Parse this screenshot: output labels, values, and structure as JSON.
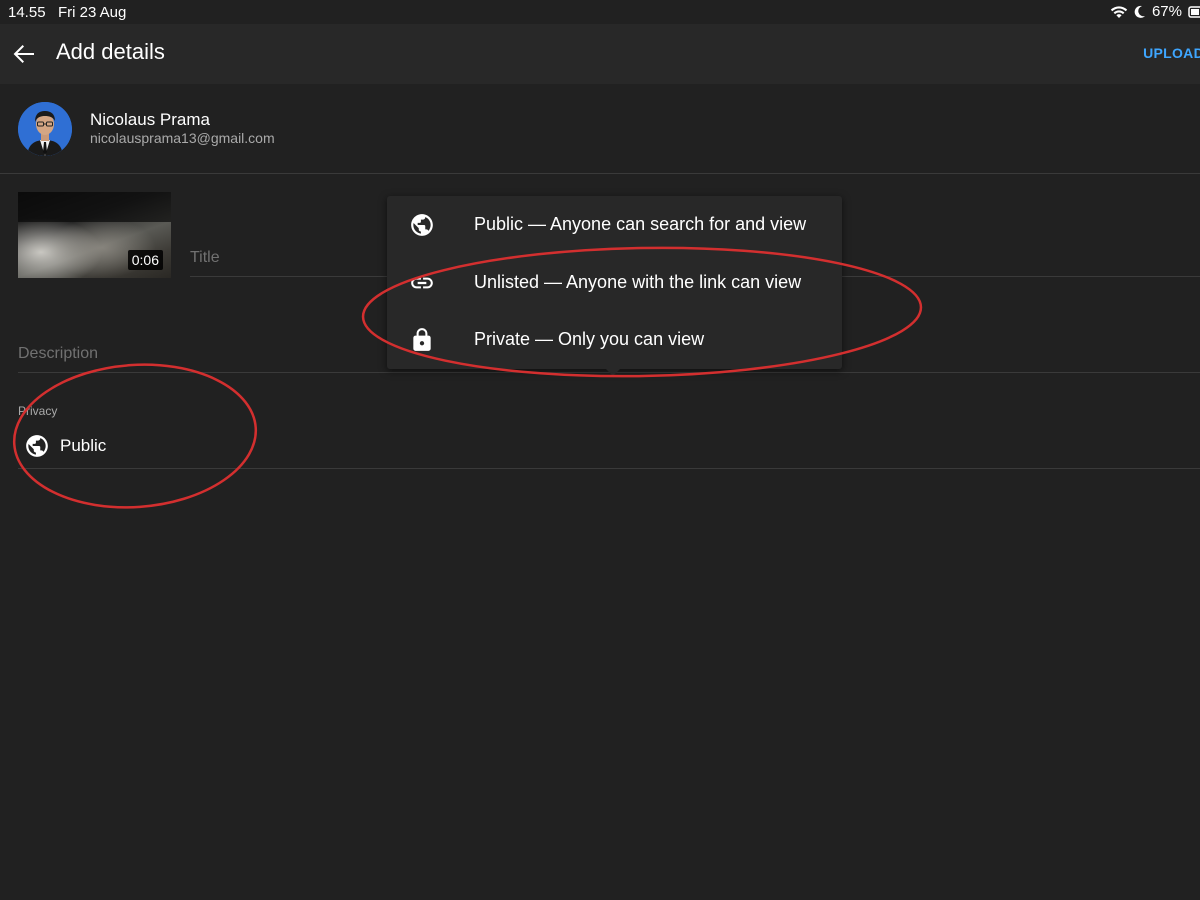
{
  "status_bar": {
    "time": "14.55",
    "date": "Fri 23 Aug",
    "battery": "67%",
    "icons": [
      "wifi-icon",
      "moon-icon",
      "battery-icon"
    ]
  },
  "app_bar": {
    "title": "Add details",
    "back_icon": "arrow-left-icon",
    "upload_label": "UPLOAD"
  },
  "account": {
    "name": "Nicolaus Prama",
    "email": "nicolausprama13@gmail.com"
  },
  "video": {
    "duration": "0:06"
  },
  "form": {
    "title_placeholder": "Title",
    "description_placeholder": "Description",
    "privacy_label": "Privacy",
    "privacy_value": "Public",
    "privacy_icon": "globe-icon"
  },
  "privacy_menu": {
    "items": [
      {
        "label": "Public — Anyone can search for and view",
        "icon": "globe-icon"
      },
      {
        "label": "Unlisted — Anyone with the link can view",
        "icon": "link-icon"
      },
      {
        "label": "Private — Only you can view",
        "icon": "lock-icon"
      }
    ]
  },
  "colors": {
    "background": "#212121",
    "app_bar": "#282828",
    "accent": "#3ea6ff",
    "annotation": "#d32f2f"
  }
}
